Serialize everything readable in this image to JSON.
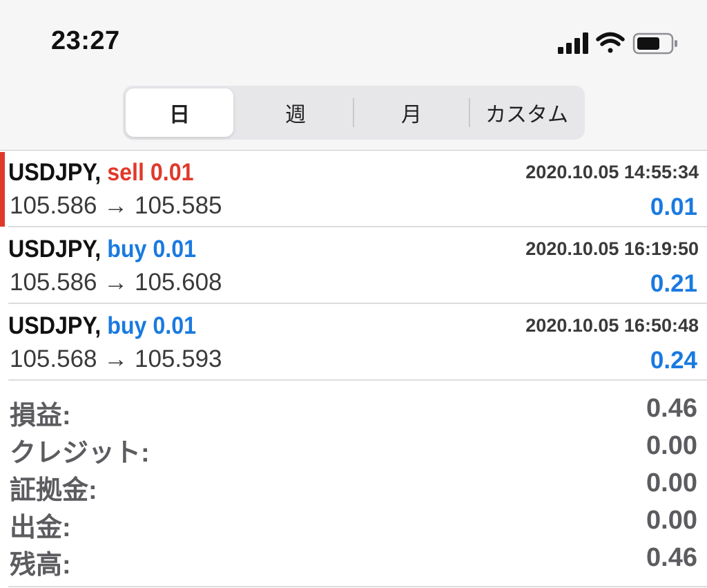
{
  "status_bar": {
    "time": "23:27",
    "icons": [
      "cellular-signal-icon",
      "wifi-icon",
      "battery-icon"
    ]
  },
  "period_tabs": [
    {
      "label": "日",
      "active": true
    },
    {
      "label": "週",
      "active": false
    },
    {
      "label": "月",
      "active": false
    },
    {
      "label": "カスタム",
      "active": false
    }
  ],
  "trades": [
    {
      "symbol": "USDJPY,",
      "side": "sell",
      "volume": "0.01",
      "side_color": "#e0392b",
      "time": "2020.10.05 14:55:34",
      "open_price": "105.586",
      "arrow": "→",
      "close_price": "105.585",
      "profit": "0.01",
      "profit_color": "#1a7ae0",
      "accent_color": "#e0392b"
    },
    {
      "symbol": "USDJPY,",
      "side": "buy",
      "volume": "0.01",
      "side_color": "#1a7ae0",
      "time": "2020.10.05 16:19:50",
      "open_price": "105.586",
      "arrow": "→",
      "close_price": "105.608",
      "profit": "0.21",
      "profit_color": "#1a7ae0",
      "accent_color": ""
    },
    {
      "symbol": "USDJPY,",
      "side": "buy",
      "volume": "0.01",
      "side_color": "#1a7ae0",
      "time": "2020.10.05 16:50:48",
      "open_price": "105.568",
      "arrow": "→",
      "close_price": "105.593",
      "profit": "0.24",
      "profit_color": "#1a7ae0",
      "accent_color": ""
    }
  ],
  "summary": {
    "profit": {
      "label": "損益:",
      "value": "0.46"
    },
    "credit": {
      "label": "クレジット:",
      "value": "0.00"
    },
    "deposit": {
      "label": "証拠金:",
      "value": "0.00"
    },
    "withdrawal": {
      "label": "出金:",
      "value": "0.00"
    },
    "balance": {
      "label": "残高:",
      "value": "0.46"
    }
  }
}
